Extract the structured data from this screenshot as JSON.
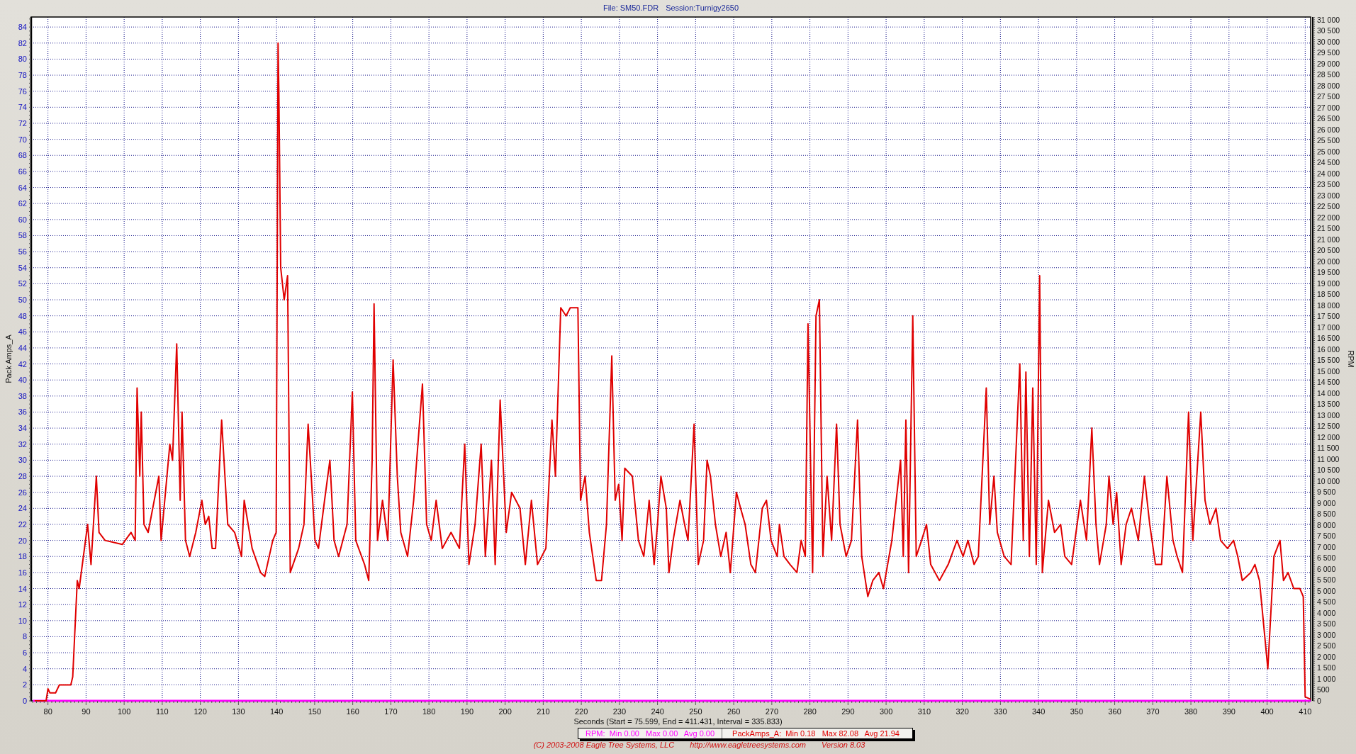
{
  "header": {
    "file": "File: SM50.FDR",
    "session": "Session:Turnigy2650"
  },
  "chart_data": {
    "type": "line",
    "xlabel": "Seconds (Start = 75.599,  End = 411.431,  Interval =  335.833)",
    "ylabel": "Pack Amps_A",
    "y2label": "RPM",
    "xlim": [
      75.599,
      411.431
    ],
    "ylim": [
      0,
      85.25
    ],
    "y2lim": [
      0,
      31125
    ],
    "xticks": [
      80,
      90,
      100,
      110,
      120,
      130,
      140,
      150,
      160,
      170,
      180,
      190,
      200,
      210,
      220,
      230,
      240,
      250,
      260,
      270,
      280,
      290,
      300,
      310,
      320,
      330,
      340,
      350,
      360,
      370,
      380,
      390,
      400,
      410
    ],
    "yticks": [
      0,
      2,
      4,
      6,
      8,
      10,
      12,
      14,
      16,
      18,
      20,
      22,
      24,
      26,
      28,
      30,
      32,
      34,
      36,
      38,
      40,
      42,
      44,
      46,
      48,
      50,
      52,
      54,
      56,
      58,
      60,
      62,
      64,
      66,
      68,
      70,
      72,
      74,
      76,
      78,
      80,
      82,
      84
    ],
    "y2ticks": [
      {
        "value": 0,
        "label": "0"
      },
      {
        "value": 500,
        "label": "500"
      },
      {
        "value": 1000,
        "label": "1 000"
      },
      {
        "value": 1500,
        "label": "1 500"
      },
      {
        "value": 2000,
        "label": "2 000"
      },
      {
        "value": 2500,
        "label": "2 500"
      },
      {
        "value": 3000,
        "label": "3 000"
      },
      {
        "value": 3500,
        "label": "3 500"
      },
      {
        "value": 4000,
        "label": "4 000"
      },
      {
        "value": 4500,
        "label": "4 500"
      },
      {
        "value": 5000,
        "label": "5 000"
      },
      {
        "value": 5500,
        "label": "5 500"
      },
      {
        "value": 6000,
        "label": "6 000"
      },
      {
        "value": 6500,
        "label": "6 500"
      },
      {
        "value": 7000,
        "label": "7 000"
      },
      {
        "value": 7500,
        "label": "7 500"
      },
      {
        "value": 8000,
        "label": "8 000"
      },
      {
        "value": 8500,
        "label": "8 500"
      },
      {
        "value": 9000,
        "label": "9 000"
      },
      {
        "value": 9500,
        "label": "9 500"
      },
      {
        "value": 10000,
        "label": "10 000"
      },
      {
        "value": 10500,
        "label": "10 500"
      },
      {
        "value": 11000,
        "label": "11 000"
      },
      {
        "value": 11500,
        "label": "11 500"
      },
      {
        "value": 12000,
        "label": "12 000"
      },
      {
        "value": 12500,
        "label": "12 500"
      },
      {
        "value": 13000,
        "label": "13 000"
      },
      {
        "value": 13500,
        "label": "13 500"
      },
      {
        "value": 14000,
        "label": "14 000"
      },
      {
        "value": 14500,
        "label": "14 500"
      },
      {
        "value": 15000,
        "label": "15 000"
      },
      {
        "value": 15500,
        "label": "15 500"
      },
      {
        "value": 16000,
        "label": "16 000"
      },
      {
        "value": 16500,
        "label": "16 500"
      },
      {
        "value": 17000,
        "label": "17 000"
      },
      {
        "value": 17500,
        "label": "17 500"
      },
      {
        "value": 18000,
        "label": "18 000"
      },
      {
        "value": 18500,
        "label": "18 500"
      },
      {
        "value": 19000,
        "label": "19 000"
      },
      {
        "value": 19500,
        "label": "19 500"
      },
      {
        "value": 20000,
        "label": "20 000"
      },
      {
        "value": 20500,
        "label": "20 500"
      },
      {
        "value": 21000,
        "label": "21 000"
      },
      {
        "value": 21500,
        "label": "21 500"
      },
      {
        "value": 22000,
        "label": "22 000"
      },
      {
        "value": 22500,
        "label": "22 500"
      },
      {
        "value": 23000,
        "label": "23 000"
      },
      {
        "value": 23500,
        "label": "23 500"
      },
      {
        "value": 24000,
        "label": "24 000"
      },
      {
        "value": 24500,
        "label": "24 500"
      },
      {
        "value": 25000,
        "label": "25 000"
      },
      {
        "value": 25500,
        "label": "25 500"
      },
      {
        "value": 26000,
        "label": "26 000"
      },
      {
        "value": 26500,
        "label": "26 500"
      },
      {
        "value": 27000,
        "label": "27 000"
      },
      {
        "value": 27500,
        "label": "27 500"
      },
      {
        "value": 28000,
        "label": "28 000"
      },
      {
        "value": 28500,
        "label": "28 500"
      },
      {
        "value": 29000,
        "label": "29 000"
      },
      {
        "value": 29500,
        "label": "29 500"
      },
      {
        "value": 30000,
        "label": "30 000"
      },
      {
        "value": 30500,
        "label": "30 500"
      },
      {
        "value": 31000,
        "label": "31 000"
      }
    ],
    "x": [
      76.5,
      79.5,
      80,
      80.5,
      82,
      83,
      86,
      86.5,
      87.7,
      88.2,
      90.4,
      91.3,
      92.7,
      93.4,
      95,
      99.5,
      101.8,
      102.9,
      103.4,
      104.1,
      104.5,
      105.2,
      106.3,
      109.1,
      109.7,
      112,
      112.7,
      113.8,
      114.7,
      115.2,
      116.1,
      117.2,
      118.8,
      120.4,
      121.3,
      122.2,
      123.1,
      124,
      125.6,
      127.2,
      129,
      130.8,
      131.5,
      133.6,
      135.8,
      136.9,
      139,
      139.9,
      140.4,
      140.6,
      141.1,
      142,
      142.9,
      143.6,
      145.8,
      147.2,
      148.3,
      150.1,
      151,
      152.6,
      154,
      155.1,
      156.3,
      158.5,
      159.9,
      160.8,
      163.1,
      164.2,
      165.1,
      165.6,
      166.5,
      167.8,
      169.2,
      170.6,
      171.7,
      172.6,
      174.4,
      176,
      178.3,
      179.4,
      180.6,
      181.9,
      183.5,
      185.8,
      188,
      189.4,
      190.5,
      192.1,
      193.7,
      194.8,
      196.4,
      197.4,
      198.7,
      200.3,
      201.7,
      203.9,
      205.3,
      206.9,
      208.5,
      210.7,
      212.3,
      213.2,
      214.6,
      216,
      217.1,
      219.1,
      219.8,
      221,
      222.1,
      223.9,
      225.3,
      226.6,
      228,
      228.9,
      229.8,
      230.7,
      231.4,
      233.4,
      235,
      236.4,
      237.8,
      239.1,
      240,
      240.9,
      242.3,
      243,
      244.1,
      245.9,
      247.1,
      248,
      249.6,
      250.7,
      252.1,
      253,
      253.9,
      255.2,
      256.6,
      258,
      259.1,
      260.7,
      261.8,
      263,
      264.5,
      265.7,
      267.5,
      268.6,
      269.8,
      271.4,
      272,
      273.2,
      274.8,
      276.6,
      277.7,
      278.8,
      279.5,
      280.7,
      281.6,
      282.5,
      283.4,
      284.5,
      285.7,
      287,
      287.9,
      289.5,
      290.9,
      292.5,
      293.6,
      295.2,
      296.5,
      298.1,
      299.3,
      301.5,
      303.8,
      304.5,
      305.2,
      305.9,
      307,
      307.9,
      309.3,
      310.6,
      311.7,
      314,
      316.3,
      318.6,
      320.2,
      321.5,
      323.1,
      324.2,
      326.3,
      327.2,
      328.3,
      329.2,
      331,
      332.8,
      335.1,
      336,
      336.7,
      337.6,
      338.5,
      339.4,
      340.3,
      341,
      342.6,
      344.2,
      345.8,
      346.9,
      348.7,
      351,
      352.6,
      354,
      355.1,
      356,
      357.8,
      358.5,
      359.6,
      360.5,
      361.7,
      363,
      364.4,
      366.2,
      367.8,
      369.2,
      370.7,
      372.3,
      373.7,
      375.3,
      376.4,
      377.8,
      379.4,
      380.5,
      382.6,
      383.7,
      385,
      386.6,
      387.8,
      389.6,
      391.2,
      392.3,
      393.5,
      395.7,
      396.8,
      398,
      400.2,
      401.8,
      403.4,
      404.3,
      405.5,
      407,
      408.6,
      409.5,
      410,
      411.4
    ],
    "grid": true,
    "series": [
      {
        "name": "RPM",
        "color": "#ff00ff",
        "axis": "y2",
        "x": [
          76,
          411.431
        ],
        "values": [
          0,
          0
        ]
      },
      {
        "name": "PackAmps_A",
        "color": "#e00000",
        "values": [
          0,
          0,
          1.5,
          1,
          1,
          2,
          2,
          3,
          15,
          14,
          22,
          17,
          28,
          21,
          20,
          19.5,
          21,
          20,
          39,
          28,
          36,
          22,
          21,
          28,
          20,
          32,
          30,
          44.5,
          25,
          36,
          20,
          18,
          21,
          25,
          22,
          23,
          19,
          19,
          35,
          22,
          21,
          18,
          25,
          19,
          16,
          15.5,
          20,
          21,
          82,
          76,
          54,
          50,
          53,
          16,
          19,
          22,
          34.5,
          20,
          19,
          25,
          30,
          20,
          18,
          22,
          38.5,
          20,
          17,
          15,
          30,
          49.5,
          20,
          25,
          20,
          42.5,
          28,
          21,
          18,
          25,
          39.5,
          22,
          20,
          25,
          19,
          21,
          19,
          32,
          17,
          22,
          32,
          18,
          30,
          17,
          37.5,
          21,
          26,
          24,
          17,
          25,
          17,
          19,
          35,
          28,
          49,
          48,
          49,
          49,
          25,
          28,
          21,
          15,
          15,
          22,
          43,
          25,
          27,
          20,
          29,
          28,
          20,
          18,
          25,
          17,
          22,
          28,
          24,
          16,
          20,
          25,
          22,
          20,
          34.5,
          17,
          20,
          30,
          28,
          22,
          18,
          21,
          16,
          26,
          24,
          22,
          17,
          16,
          24,
          25,
          20,
          18,
          22,
          18,
          17,
          16,
          20,
          18,
          47,
          16,
          48,
          50,
          18,
          28,
          20,
          34.5,
          22,
          18,
          20,
          35,
          18,
          13,
          15,
          16,
          14,
          20,
          30,
          18,
          35,
          16,
          48,
          18,
          20,
          22,
          17,
          15,
          17,
          20,
          18,
          20,
          17,
          18,
          39,
          22,
          28,
          21,
          18,
          17,
          42,
          20,
          41,
          18,
          39,
          17,
          53,
          16,
          25,
          21,
          22,
          18,
          17,
          25,
          20,
          34,
          22,
          17,
          22,
          28,
          22,
          26,
          17,
          22,
          24,
          20,
          28,
          22,
          17,
          17,
          28,
          20,
          18,
          16,
          36,
          20,
          36,
          25,
          22,
          24,
          20,
          19,
          20,
          18,
          15,
          16,
          17,
          15,
          4,
          18,
          20,
          15,
          16,
          14,
          14,
          13,
          0.5,
          0.2
        ]
      }
    ]
  },
  "legend": [
    {
      "stats": ":  Min 0.00   Max 0.00   Avg 0.00"
    },
    {
      "stats": ":  Min 0.18   Max 82.08   Avg 21.94"
    }
  ],
  "footer": [
    "(C) 2003-2008 Eagle Tree Systems, LLC",
    "http://www.eagletreesystems.com",
    "Version 8.03"
  ]
}
